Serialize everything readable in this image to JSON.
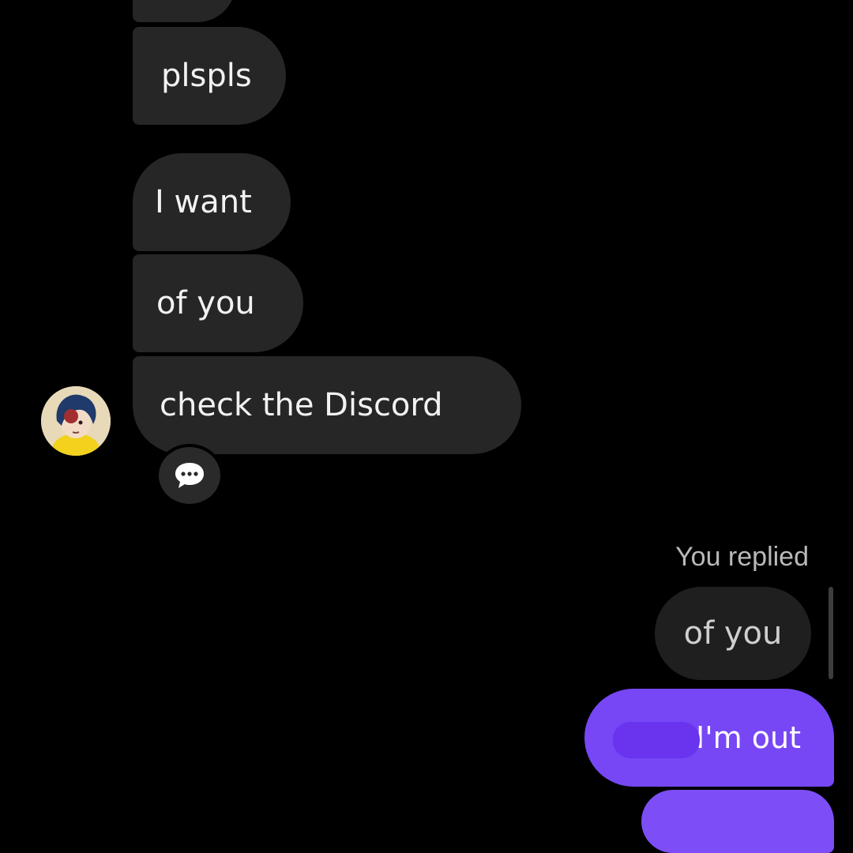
{
  "messages": {
    "incoming": [
      {
        "text": "plspls"
      },
      {
        "text": "I want"
      },
      {
        "text": "of you"
      },
      {
        "text": "check the Discord"
      }
    ],
    "reaction_icon": "speech-bubble-ellipsis",
    "reply": {
      "label": "You replied",
      "quoted_text": "of you",
      "message_text": "I'm out"
    }
  },
  "colors": {
    "background": "#000000",
    "incoming_bubble": "#262626",
    "outgoing_bubble": "#7747f5",
    "quoted_bubble": "#1f1f1f",
    "muted_text": "#b9b9b9"
  }
}
